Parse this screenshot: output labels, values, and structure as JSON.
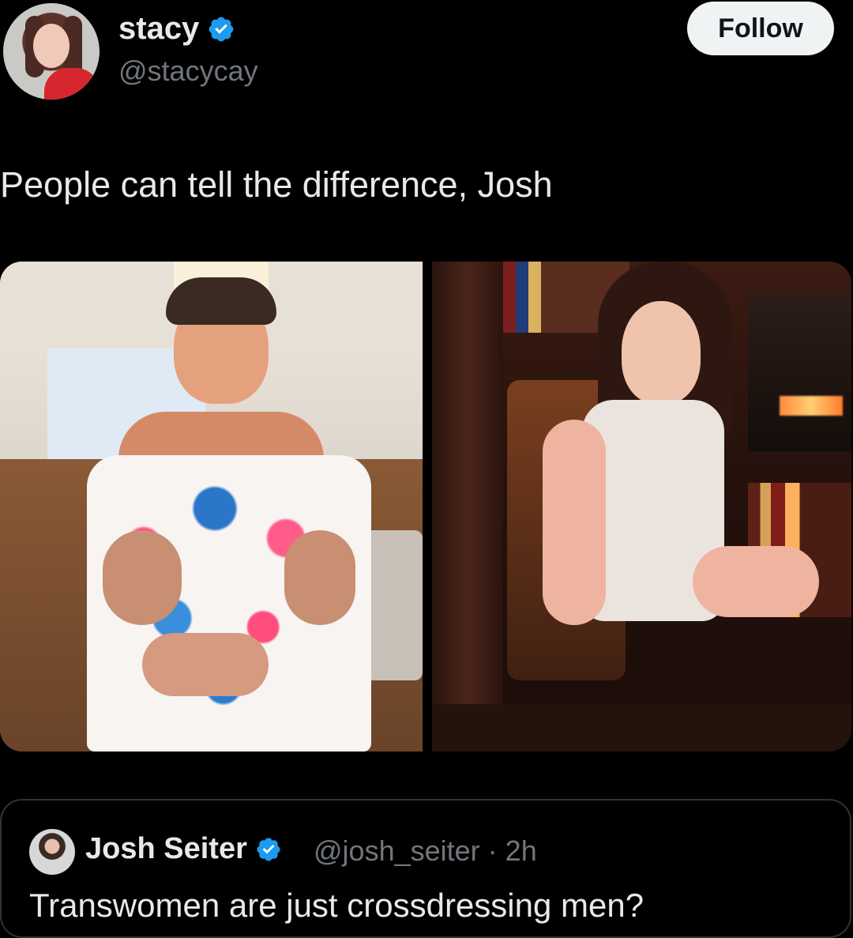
{
  "post": {
    "author": {
      "name": "stacy",
      "handle": "@stacycay",
      "verified": true,
      "avatar_icon": "profile-photo-icon"
    },
    "follow_label": "Follow",
    "text": "People can tell the difference, Josh",
    "media": [
      {
        "kind": "photo",
        "icon": "photo-man-in-floral-dress"
      },
      {
        "kind": "photo",
        "icon": "photo-woman-in-white-dress"
      }
    ]
  },
  "quoted_post": {
    "author": {
      "name": "Josh Seiter",
      "handle": "@josh_seiter",
      "time": "2h",
      "verified": true,
      "avatar_icon": "profile-photo-icon"
    },
    "separator": "·",
    "text": "Transwomen are just crossdressing men?"
  },
  "colors": {
    "background": "#000000",
    "primary_text": "#e7e9ea",
    "secondary_text": "#71767b",
    "verified_blue": "#1d9bf0",
    "follow_button_bg": "#eff3f4"
  }
}
